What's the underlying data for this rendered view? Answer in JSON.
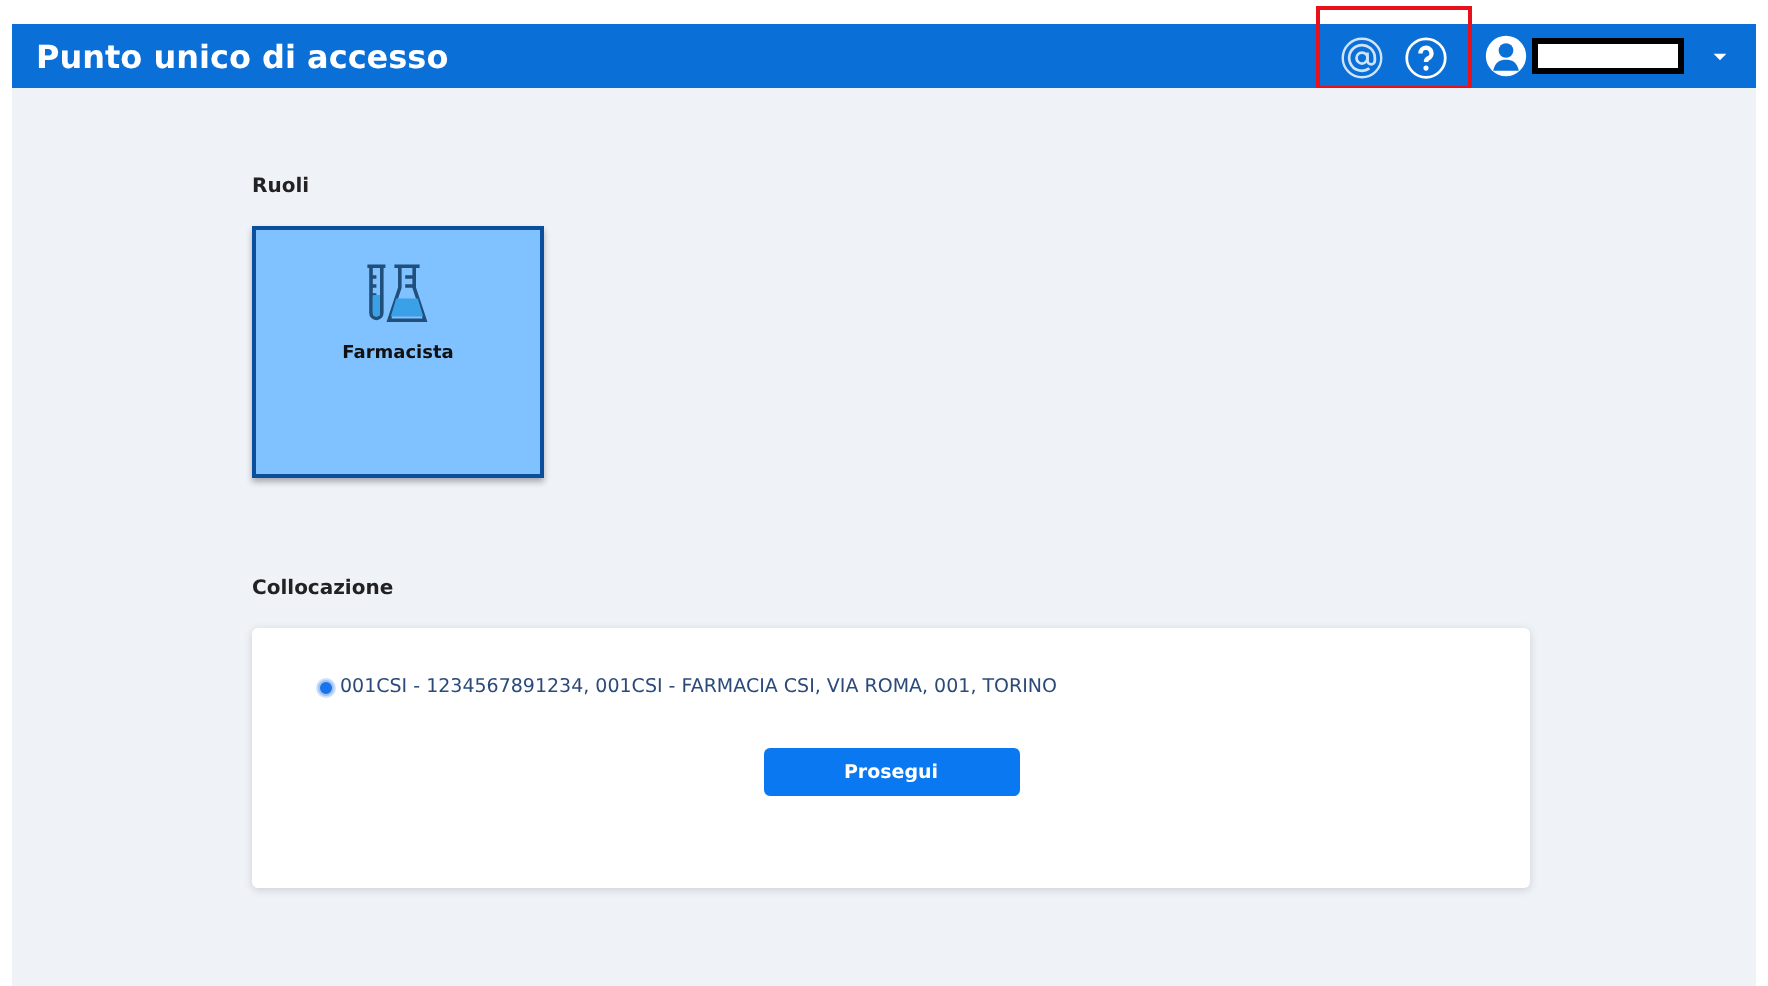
{
  "header": {
    "title": "Punto unico di accesso"
  },
  "roles": {
    "heading": "Ruoli",
    "items": [
      {
        "label": "Farmacista",
        "selected": true
      }
    ]
  },
  "location": {
    "heading": "Collocazione",
    "options": [
      {
        "label": "001CSI - 1234567891234, 001CSI - FARMACIA CSI, VIA ROMA, 001, TORINO",
        "selected": true
      }
    ]
  },
  "button": "Prosegui"
}
